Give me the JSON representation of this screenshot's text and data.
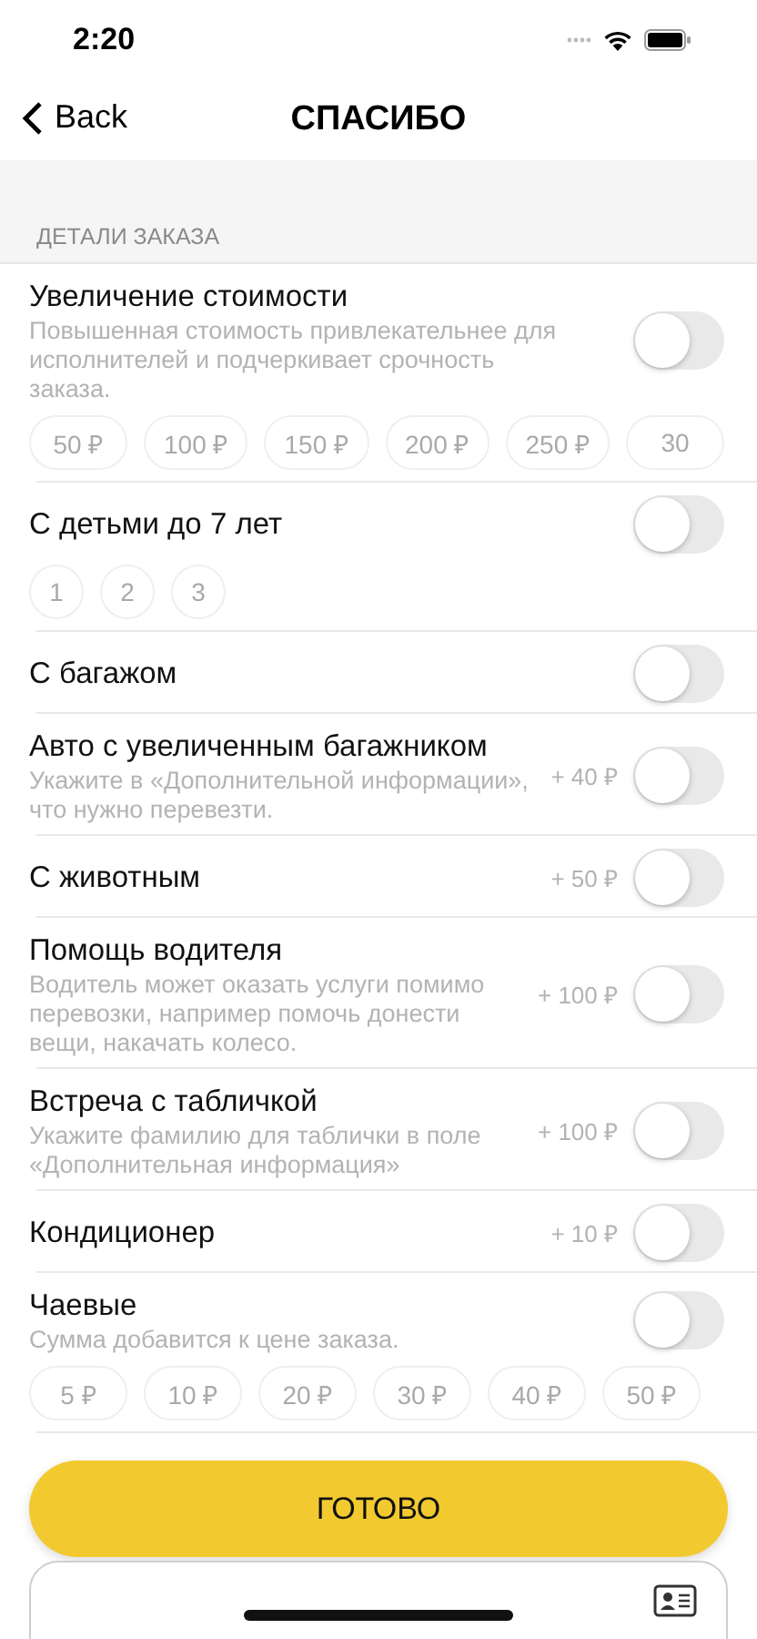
{
  "status_bar": {
    "time": "2:20"
  },
  "nav": {
    "back": "Back",
    "title": "СПАСИБО"
  },
  "section": {
    "header": "ДЕТАЛИ ЗАКАЗА"
  },
  "options": [
    {
      "title": "Увеличение стоимости",
      "description": "Повышенная стоимость привлекательнее для исполнителей и подчеркивает срочность заказа.",
      "on": false,
      "round_chips": false,
      "chips": [
        "50 ₽",
        "100 ₽",
        "150 ₽",
        "200 ₽",
        "250 ₽",
        "30"
      ]
    },
    {
      "title": "С детьми до 7 лет",
      "on": false,
      "chips": [
        "1",
        "2",
        "3"
      ],
      "round_chips": true
    },
    {
      "title": "С багажом",
      "on": false
    },
    {
      "title": "Авто с увеличенным багажником",
      "description": "Укажите в «Дополнительной информации», что нужно перевезти.",
      "price": "+ 40 ₽",
      "on": false
    },
    {
      "title": "С животным",
      "price": "+ 50 ₽",
      "on": false
    },
    {
      "title": "Помощь водителя",
      "description": "Водитель может оказать услуги помимо перевозки, например помочь донести вещи, накачать колесо.",
      "price": "+ 100 ₽",
      "on": false
    },
    {
      "title": "Встреча с табличкой",
      "description": "Укажите фамилию для таблички в поле «Дополнительная информация»",
      "price": "+ 100 ₽",
      "on": false
    },
    {
      "title": "Кондиционер",
      "price": "+ 10 ₽",
      "on": false
    },
    {
      "title": "Чаевые",
      "description": "Сумма добавится к цене заказа.",
      "on": false,
      "round_chips": false,
      "chips": [
        "5 ₽",
        "10 ₽",
        "20 ₽",
        "30 ₽",
        "40 ₽",
        "50 ₽"
      ]
    }
  ],
  "done_button": "ГОТОВО"
}
